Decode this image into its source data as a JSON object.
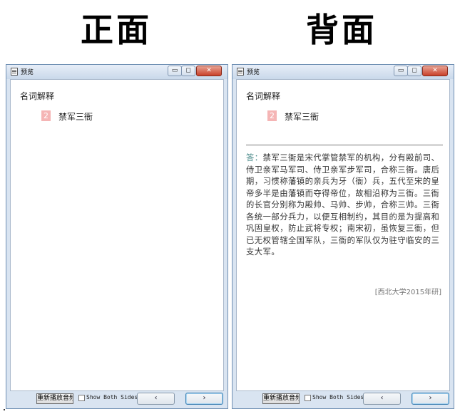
{
  "headings": {
    "front": "正面",
    "back": "背面"
  },
  "windows": {
    "front": {
      "title": "预览",
      "min_icon": "▭",
      "max_icon": "◻",
      "close_icon": "✕",
      "question_label": "名词解释",
      "item_number": "2",
      "term": "禁军三衙",
      "replay_button": "重新播放音频",
      "show_both_sides": "Show Both Sides",
      "prev_button": "‹",
      "next_button": "›"
    },
    "back": {
      "title": "预览",
      "min_icon": "▭",
      "max_icon": "◻",
      "close_icon": "✕",
      "question_label": "名词解释",
      "item_number": "2",
      "term": "禁军三衙",
      "answer_lead": "答：",
      "answer_text": "禁军三衙是宋代掌管禁军的机构，分有殿前司、侍卫亲军马军司、侍卫亲军步军司，合称三衙。唐后期，习惯称藩镇的亲兵为牙（衙）兵，五代至宋的皇帝多半是由藩镇而夺得帝位，故相沿称为三衙。三衙的长官分别称为殿帅、马帅、步帅，合称三帅。三衙各统一部分兵力，以便互相制约，其目的是为提高和巩固皇权，防止武将专权；南宋初，虽恢复三衙，但已无权管辖全国军队，三衙的军队仅为驻守临安的三支大军。",
      "source": "[西北大学2015年研]",
      "replay_button": "重新播放音频",
      "show_both_sides": "Show Both Sides",
      "prev_button": "‹",
      "next_button": "›"
    }
  },
  "colors": {
    "number_badge": "#f5b5b5",
    "answer_lead": "#4a8a8a",
    "close_button": "#c9412a"
  },
  "icons": {
    "app": "document-icon",
    "minimize": "minimize-icon",
    "maximize": "maximize-icon",
    "close": "close-icon"
  }
}
